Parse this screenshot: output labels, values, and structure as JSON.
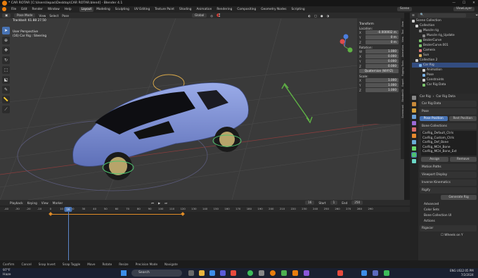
{
  "titlebar": {
    "title": "* CAR ROTAR [C:\\Users\\lepas\\Desktop\\CAR ROTAR.blend] - Blender 4.1"
  },
  "menu": {
    "items": [
      "File",
      "Edit",
      "Render",
      "Window",
      "Help"
    ]
  },
  "workspaces": [
    {
      "label": "Layout",
      "active": true
    },
    {
      "label": "Modeling"
    },
    {
      "label": "Sculpting"
    },
    {
      "label": "UV Editing"
    },
    {
      "label": "Texture Paint"
    },
    {
      "label": "Shading"
    },
    {
      "label": "Animation"
    },
    {
      "label": "Rendering"
    },
    {
      "label": "Compositing"
    },
    {
      "label": "Geometry Nodes"
    },
    {
      "label": "Scripting"
    }
  ],
  "scene": {
    "label": "Scene",
    "view_layer": "ViewLayer"
  },
  "viewport": {
    "mode": "Pose Mode",
    "menus": [
      "View",
      "Select",
      "Pose"
    ],
    "orientation": "Global",
    "trackball": "Trackball: 61.88 27.50",
    "info_line1": "User Perspective",
    "info_line2": "(16) Car Rig : Steering"
  },
  "npanel": {
    "transform_title": "Transform",
    "location_label": "Location:",
    "location": [
      {
        "axis": "X",
        "value": "-0.000002 m"
      },
      {
        "axis": "Y",
        "value": "0 m"
      },
      {
        "axis": "Z",
        "value": "0 m"
      }
    ],
    "rotation_label": "Rotation:",
    "rotation": [
      {
        "axis": "W",
        "value": "1.000"
      },
      {
        "axis": "X",
        "value": "0.000"
      },
      {
        "axis": "Y",
        "value": "0.000"
      },
      {
        "axis": "Z",
        "value": "0.000"
      }
    ],
    "rotation_mode": "Quaternion (WXYZ)",
    "scale_label": "Scale:",
    "scale": [
      {
        "axis": "X",
        "value": "1.000"
      },
      {
        "axis": "Y",
        "value": "1.000"
      },
      {
        "axis": "Z",
        "value": "1.000"
      }
    ],
    "tabs": [
      "Item",
      "Tool",
      "View",
      "Animation",
      "Rigging Tools",
      "Export",
      "BlenderKit",
      "Screencast"
    ]
  },
  "outliner": {
    "items": [
      {
        "label": "Scene Collection",
        "indent": 0,
        "color": "#cfcfcf"
      },
      {
        "label": "Collection",
        "indent": 1,
        "color": "#cfcfcf"
      },
      {
        "label": "Muscle rig",
        "indent": 2,
        "color": "#8a8a8a"
      },
      {
        "label": "Muscle rig_Update",
        "indent": 3,
        "color": "#8a8a8a"
      },
      {
        "label": "BezierCurve",
        "indent": 2,
        "color": "#7cc46d"
      },
      {
        "label": "BezierCurve.001",
        "indent": 2,
        "color": "#7cc46d"
      },
      {
        "label": "Camera",
        "indent": 2,
        "color": "#e07b7b"
      },
      {
        "label": "Sun",
        "indent": 2,
        "color": "#e0b45c"
      },
      {
        "label": "Collection 2",
        "indent": 1,
        "color": "#cfcfcf"
      },
      {
        "label": "Car Rig",
        "indent": 2,
        "color": "#7bb2e8",
        "selected": true
      },
      {
        "label": "Animation",
        "indent": 3,
        "color": "#cfcfcf"
      },
      {
        "label": "Pose",
        "indent": 3,
        "color": "#7bb2e8"
      },
      {
        "label": "Constraints",
        "indent": 3,
        "color": "#cfcfcf"
      },
      {
        "label": "Car Rig Data",
        "indent": 3,
        "color": "#7cc46d"
      }
    ]
  },
  "properties": {
    "breadcrumb": "Car Rig",
    "breadcrumb2": "Car Rig Data",
    "datablock": "Car Rig Data",
    "pose_section": "Pose",
    "pose_position": "Pose Position",
    "rest_position": "Rest Position",
    "bone_collections_section": "Bone Collections",
    "collections": [
      "CarRig_Default_Ctrls",
      "CarRig_Custom_Ctrls",
      "CarRig_Def_Bone",
      "CarRig_MCH_Bone",
      "CarRig_MCH_Bone_Ext"
    ],
    "assign": "Assign",
    "remove": "Remove",
    "sections": [
      "Motion Paths",
      "Viewport Display",
      "Inverse Kinematics",
      "Rigify"
    ],
    "generate_rig": "Generate Rig",
    "subsections": [
      "Advanced",
      "Color Sets",
      "Bone Collection UI",
      "Actions"
    ],
    "rigacar": "Rigacar",
    "wheels_on_y": "Wheels on Y"
  },
  "timeline": {
    "menus": [
      "Playback",
      "Keying",
      "View",
      "Marker"
    ],
    "current_frame": "16",
    "start_label": "Start",
    "start": "1",
    "end_label": "End",
    "end": "250",
    "ticks": [
      "-40",
      "-30",
      "-20",
      "-10",
      "0",
      "10",
      "20",
      "30",
      "40",
      "50",
      "60",
      "70",
      "80",
      "90",
      "100",
      "110",
      "120",
      "130",
      "140",
      "150",
      "160",
      "170",
      "180",
      "190",
      "200",
      "210",
      "220",
      "230",
      "240",
      "250",
      "260",
      "270",
      "280",
      "290"
    ],
    "keyframes": [
      0,
      120
    ]
  },
  "statusbar": {
    "items": [
      "Confirm",
      "Cancel",
      "Snap Invert",
      "Snap Toggle",
      "Move",
      "Rotate",
      "Resize",
      "Precision Mode",
      "Navigate"
    ]
  },
  "taskbar": {
    "weather_temp": "97°F",
    "weather_label": "Haze",
    "search": "Search",
    "time": "12:05 PM",
    "date": "7/2/2024",
    "lang": "ENG US"
  },
  "colors": {
    "accent": "#4772b3",
    "car": "#7c8fd4",
    "keyframe": "#e08c27"
  }
}
